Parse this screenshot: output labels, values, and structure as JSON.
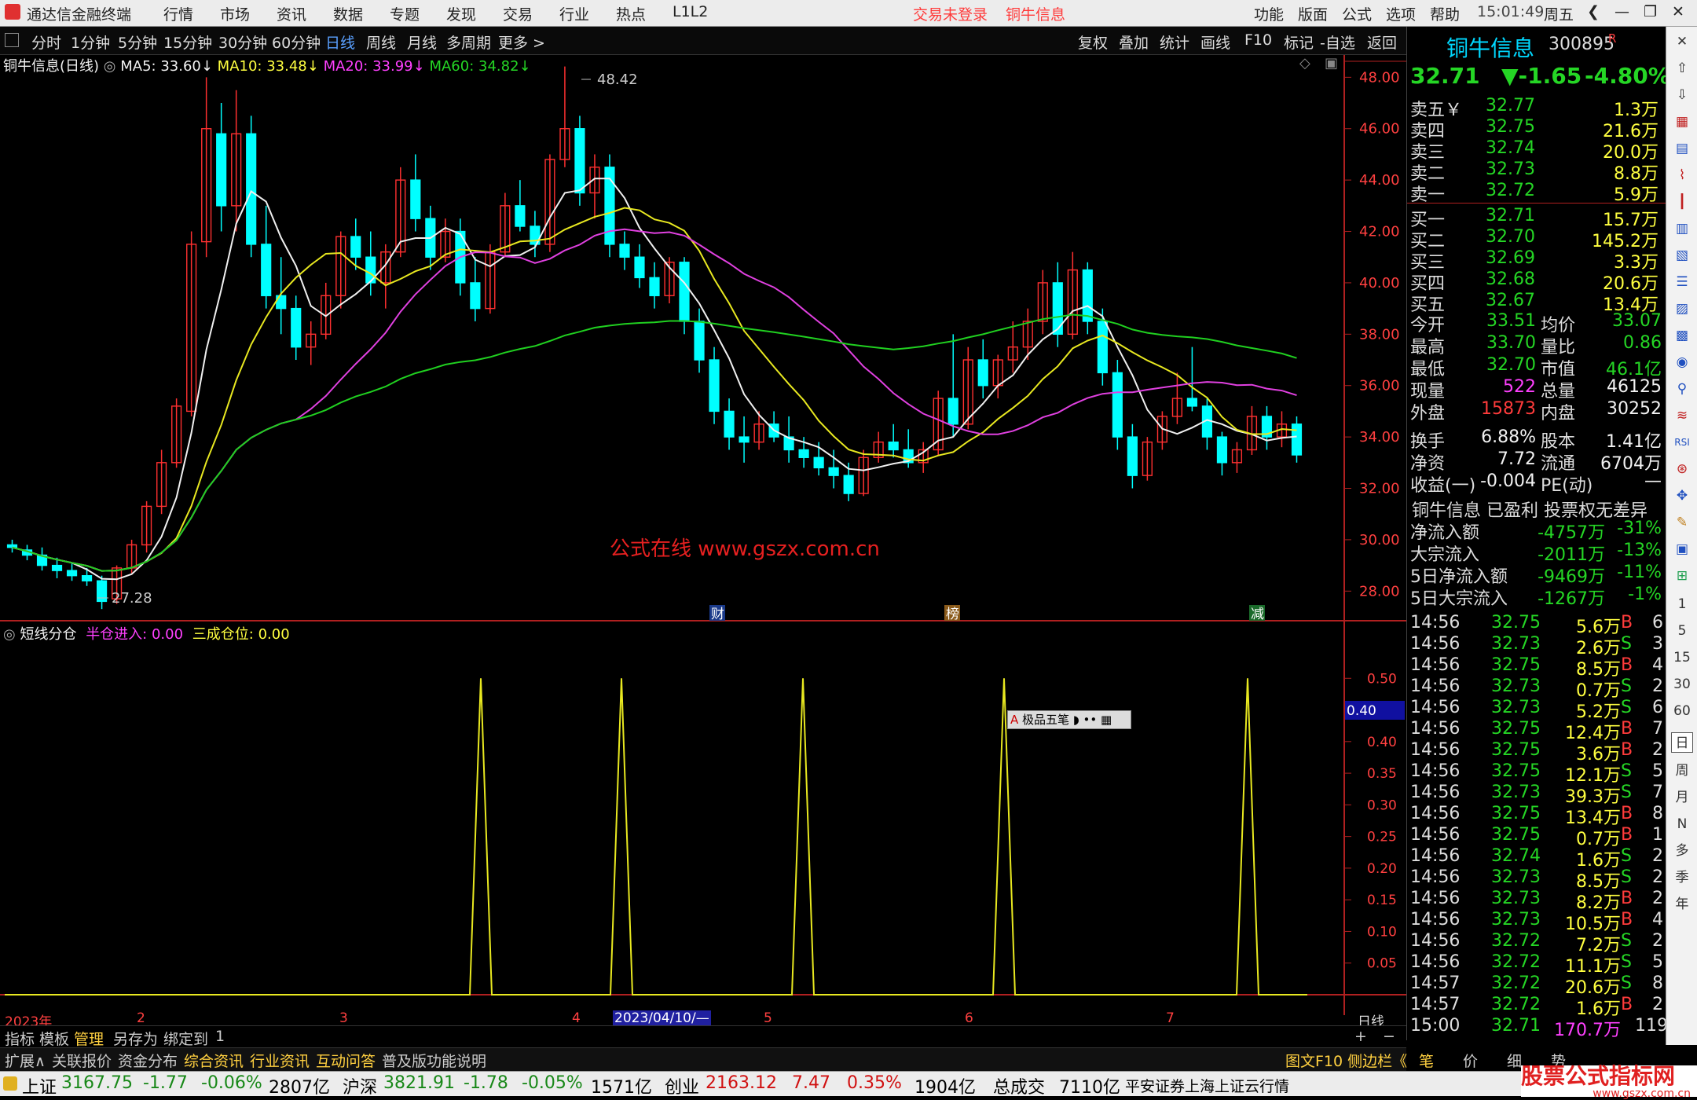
{
  "titlebar": {
    "app": "通达信金融终端",
    "menus": [
      "行情",
      "市场",
      "资讯",
      "数据",
      "专题",
      "发现",
      "交易",
      "行业",
      "热点",
      "L1L2"
    ],
    "notice1": "交易未登录",
    "notice2": "铜牛信息",
    "right_menus": [
      "功能",
      "版面",
      "公式",
      "选项",
      "帮助"
    ],
    "time": "15:01:49",
    "weekday": "周五"
  },
  "toolbar": {
    "periods": [
      "分时",
      "1分钟",
      "5分钟",
      "15分钟",
      "30分钟",
      "60分钟",
      "日线",
      "周线",
      "月线",
      "多周期",
      "更多 >"
    ],
    "active": "日线",
    "actions": [
      "复权",
      "叠加",
      "统计",
      "画线",
      "F10",
      "标记",
      "-自选",
      "返回"
    ]
  },
  "chart": {
    "stock_label": "铜牛信息(日线)",
    "ma5": "MA5: 33.60↓",
    "ma10": "MA10: 33.48↓",
    "ma20": "MA20: 33.99↓",
    "ma60": "MA60: 34.82↓",
    "high_label": "48.42",
    "low_label": "27.28",
    "watermark": "公式在线  www.gszx.com.cn",
    "price_axis": [
      "48.00",
      "46.00",
      "44.00",
      "42.00",
      "40.00",
      "38.00",
      "36.00",
      "34.00",
      "32.00",
      "30.00",
      "28.00"
    ],
    "event_markers": [
      "财",
      "榜",
      "减"
    ],
    "indicator_name": "短线分仓",
    "ind_label1": "半仓进入: 0.00",
    "ind_label2": "三成仓位: 0.00",
    "ind_axis": [
      "0.50",
      "0.45",
      "0.40",
      "0.35",
      "0.30",
      "0.25",
      "0.20",
      "0.15",
      "0.10",
      "0.05"
    ],
    "ind_cursor": "0.40",
    "ime": "极品五笔",
    "date_axis": [
      "2023年",
      "2",
      "3",
      "4",
      "2023/04/10/—",
      "5",
      "6",
      "7"
    ],
    "period_label": "日线"
  },
  "chart_data": {
    "type": "candlestick",
    "ylim": [
      27,
      48.5
    ],
    "x": [
      "2023-01",
      "2023-02",
      "2023-03",
      "2023-04",
      "2023-05",
      "2023-06",
      "2023-07"
    ],
    "ohlc": [
      [
        29.8,
        30,
        29.5,
        29.7
      ],
      [
        29.6,
        29.8,
        29.2,
        29.4
      ],
      [
        29.4,
        29.7,
        28.8,
        29
      ],
      [
        29,
        29.3,
        28.5,
        28.8
      ],
      [
        28.8,
        29.1,
        28.4,
        28.6
      ],
      [
        28.6,
        28.9,
        28.2,
        28.4
      ],
      [
        28.4,
        28.6,
        27.3,
        27.6
      ],
      [
        27.7,
        29,
        27.5,
        28.9
      ],
      [
        28.9,
        30,
        28.7,
        29.8
      ],
      [
        29.8,
        31.5,
        29.5,
        31.3
      ],
      [
        31.3,
        33.5,
        31,
        33
      ],
      [
        33,
        35.5,
        32.8,
        35.2
      ],
      [
        35,
        42,
        34.8,
        41.5
      ],
      [
        41.6,
        48,
        41,
        46
      ],
      [
        45.8,
        47,
        42,
        43
      ],
      [
        43,
        47.5,
        42,
        45.8
      ],
      [
        45.8,
        46.5,
        41,
        41.5
      ],
      [
        41.5,
        43,
        39,
        39.5
      ],
      [
        39.5,
        41,
        38,
        39
      ],
      [
        39,
        39.5,
        37,
        37.5
      ],
      [
        37.5,
        38.5,
        36.8,
        38
      ],
      [
        38,
        40,
        37.8,
        39.5
      ],
      [
        39.5,
        42,
        39,
        41.8
      ],
      [
        41.8,
        42.5,
        40.5,
        41
      ],
      [
        41,
        42,
        39.5,
        40
      ],
      [
        40,
        41.5,
        39,
        41.2
      ],
      [
        41.2,
        44.5,
        41,
        44
      ],
      [
        44,
        45,
        42,
        42.5
      ],
      [
        42.5,
        43,
        40.5,
        41
      ],
      [
        41,
        42.5,
        40.8,
        42
      ],
      [
        42,
        42.5,
        39.5,
        40
      ],
      [
        40,
        41,
        38.5,
        39
      ],
      [
        39,
        41.5,
        38.8,
        41.2
      ],
      [
        41.2,
        43.5,
        41,
        43
      ],
      [
        43,
        44,
        42,
        42.2
      ],
      [
        42.2,
        42.8,
        41,
        41.5
      ],
      [
        41.5,
        45,
        41.2,
        44.8
      ],
      [
        44.8,
        48.42,
        44.5,
        46
      ],
      [
        46,
        46.5,
        43,
        43.5
      ],
      [
        43.5,
        45,
        42.5,
        44.5
      ],
      [
        44.5,
        45,
        41,
        41.5
      ],
      [
        41.5,
        42,
        40.5,
        41
      ],
      [
        41,
        41.5,
        39.8,
        40.2
      ],
      [
        40.2,
        40.8,
        39,
        39.5
      ],
      [
        39.5,
        41,
        39.2,
        40.8
      ],
      [
        40.8,
        41,
        38,
        38.5
      ],
      [
        38.5,
        39,
        36.5,
        37
      ],
      [
        37,
        37.5,
        34.5,
        35
      ],
      [
        35,
        35.5,
        33.5,
        34
      ],
      [
        34,
        34.8,
        33,
        33.8
      ],
      [
        33.8,
        35,
        33.5,
        34.5
      ],
      [
        34.5,
        35,
        33.8,
        34
      ],
      [
        34,
        34.8,
        33,
        33.5
      ],
      [
        33.5,
        34,
        32.8,
        33.2
      ],
      [
        33.2,
        33.8,
        32.5,
        32.8
      ],
      [
        32.8,
        33.5,
        32,
        32.5
      ],
      [
        32.5,
        33,
        31.5,
        31.8
      ],
      [
        31.8,
        33.5,
        31.7,
        33.2
      ],
      [
        33.2,
        34.2,
        33,
        33.8
      ],
      [
        33.8,
        34.5,
        33.2,
        33.5
      ],
      [
        33.5,
        34.3,
        32.8,
        33
      ],
      [
        33,
        33.8,
        32.6,
        33.5
      ],
      [
        33.5,
        35.8,
        33.3,
        35.5
      ],
      [
        35.5,
        38,
        34,
        34.5
      ],
      [
        34.5,
        37.5,
        34.3,
        37
      ],
      [
        37,
        37.8,
        35.5,
        36
      ],
      [
        36,
        37.2,
        35.5,
        37
      ],
      [
        37,
        38.5,
        36.5,
        37.5
      ],
      [
        37.5,
        39,
        37,
        38.5
      ],
      [
        38.5,
        40.5,
        38,
        40
      ],
      [
        40,
        40.8,
        37.5,
        38
      ],
      [
        38,
        41.2,
        37.8,
        40.5
      ],
      [
        40.5,
        40.8,
        38,
        38.5
      ],
      [
        38.5,
        39,
        36,
        36.5
      ],
      [
        36.5,
        37,
        33.5,
        34
      ],
      [
        34,
        34.5,
        32,
        32.5
      ],
      [
        32.5,
        34,
        32.3,
        33.8
      ],
      [
        33.8,
        35,
        33.5,
        34.8
      ],
      [
        34.8,
        36.5,
        34.5,
        35.5
      ],
      [
        35.5,
        37.5,
        35,
        35.2
      ],
      [
        35.2,
        35.5,
        33.5,
        34
      ],
      [
        34,
        34.2,
        32.5,
        33
      ],
      [
        33,
        33.8,
        32.6,
        33.5
      ],
      [
        33.5,
        35.2,
        33.3,
        34.8
      ],
      [
        34.8,
        35.2,
        33.5,
        34
      ],
      [
        34,
        35,
        33.6,
        34.5
      ],
      [
        34.5,
        34.8,
        33,
        33.3
      ]
    ],
    "indicator_peaks_x": [
      "2023-03",
      "2023-04",
      "2023-05",
      "2023-06",
      "2023-07"
    ],
    "indicator_peak_value": 0.5
  },
  "right": {
    "name": "铜牛信息",
    "code": "300895",
    "r": "R",
    "price": "32.71",
    "change": "▼-1.65",
    "pct": "-4.80%",
    "asks": [
      [
        "卖五￥",
        "32.77",
        "1.3万"
      ],
      [
        "卖四",
        "32.75",
        "21.6万"
      ],
      [
        "卖三",
        "32.74",
        "20.0万"
      ],
      [
        "卖二",
        "32.73",
        "8.8万"
      ],
      [
        "卖一",
        "32.72",
        "5.9万"
      ]
    ],
    "bids": [
      [
        "买一",
        "32.71",
        "15.7万"
      ],
      [
        "买二",
        "32.70",
        "145.2万"
      ],
      [
        "买三",
        "32.69",
        "3.3万"
      ],
      [
        "买四",
        "32.68",
        "20.6万"
      ],
      [
        "买五",
        "32.67",
        "13.4万"
      ]
    ],
    "stats": [
      [
        "今开",
        "33.51",
        "均价",
        "33.07"
      ],
      [
        "最高",
        "33.70",
        "量比",
        "0.86"
      ],
      [
        "最低",
        "32.70",
        "市值",
        "46.1亿"
      ],
      [
        "现量",
        "522",
        "总量",
        "46125"
      ],
      [
        "外盘",
        "15873",
        "内盘",
        "30252"
      ],
      [
        "换手",
        "6.88%",
        "股本",
        "1.41亿"
      ],
      [
        "净资",
        "7.72",
        "流通",
        "6704万"
      ],
      [
        "收益(一)",
        "-0.004",
        "PE(动)",
        "—"
      ]
    ],
    "headline": "铜牛信息 已盈利 投票权无差异",
    "flows": [
      [
        "净流入额",
        "-4757万",
        "-31%"
      ],
      [
        "大宗流入",
        "-2011万",
        "-13%"
      ],
      [
        "5日净流入额",
        "-9469万",
        "-11%"
      ],
      [
        "5日大宗流入",
        "-1267万",
        "-1%"
      ]
    ],
    "ticks": [
      [
        "14:56",
        "32.75",
        "5.6万",
        "B",
        "6"
      ],
      [
        "14:56",
        "32.73",
        "2.6万",
        "S",
        "3"
      ],
      [
        "14:56",
        "32.75",
        "8.5万",
        "B",
        "4"
      ],
      [
        "14:56",
        "32.73",
        "0.7万",
        "S",
        "2"
      ],
      [
        "14:56",
        "32.73",
        "5.2万",
        "S",
        "6"
      ],
      [
        "14:56",
        "32.75",
        "12.4万",
        "B",
        "7"
      ],
      [
        "14:56",
        "32.75",
        "3.6万",
        "B",
        "2"
      ],
      [
        "14:56",
        "32.75",
        "12.1万",
        "S",
        "5"
      ],
      [
        "14:56",
        "32.73",
        "39.3万",
        "S",
        "7"
      ],
      [
        "14:56",
        "32.75",
        "13.4万",
        "B",
        "8"
      ],
      [
        "14:56",
        "32.75",
        "0.7万",
        "B",
        "1"
      ],
      [
        "14:56",
        "32.74",
        "1.6万",
        "S",
        "2"
      ],
      [
        "14:56",
        "32.73",
        "8.5万",
        "S",
        "2"
      ],
      [
        "14:56",
        "32.73",
        "8.2万",
        "B",
        "2"
      ],
      [
        "14:56",
        "32.73",
        "10.5万",
        "B",
        "4"
      ],
      [
        "14:56",
        "32.72",
        "7.2万",
        "S",
        "2"
      ],
      [
        "14:56",
        "32.72",
        "11.1万",
        "S",
        "5"
      ],
      [
        "14:57",
        "32.72",
        "20.6万",
        "S",
        "8"
      ],
      [
        "14:57",
        "32.72",
        "1.6万",
        "B",
        "2"
      ],
      [
        "15:00",
        "32.71",
        "170.7万",
        "",
        "119"
      ]
    ]
  },
  "sidebar": [
    "1",
    "5",
    "15",
    "30",
    "60",
    "日",
    "周",
    "月",
    "N",
    "多",
    "季",
    "年"
  ],
  "bottom1": {
    "items": [
      "指标",
      "模板",
      "管理",
      "另存为",
      "绑定到",
      "1"
    ],
    "plus": "+",
    "minus": "−"
  },
  "bottom2": {
    "items": [
      "扩展∧",
      "关联报价",
      "资金分布",
      "综合资讯",
      "行业资讯",
      "互动问答",
      "普及版功能说明"
    ],
    "right": "图文F10  侧边栏《",
    "tabs": [
      "笔",
      "价",
      "细",
      "势"
    ]
  },
  "status": {
    "idx": [
      [
        "上证",
        "3167.75",
        "-1.77",
        "-0.06%",
        "2807亿"
      ],
      [
        "沪深",
        "3821.91",
        "-1.78",
        "-0.05%",
        "1571亿"
      ],
      [
        "创业",
        "2163.12",
        "7.47",
        "0.35%",
        "1904亿"
      ]
    ],
    "total_label": "总成交",
    "total": "7110亿",
    "server": "平安证券上海上证云行情",
    "brand": "股票公式指标网",
    "brand_url": "www.gszx.com.cn"
  }
}
